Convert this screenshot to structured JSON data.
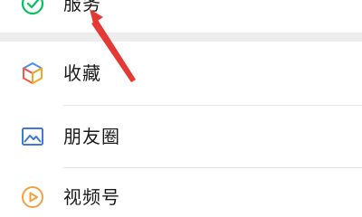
{
  "menu": {
    "items": [
      {
        "label": "服务",
        "icon": "services-icon"
      },
      {
        "label": "收藏",
        "icon": "favorites-cube-icon"
      },
      {
        "label": "朋友圈",
        "icon": "moments-picture-icon"
      },
      {
        "label": "视频号",
        "icon": "channels-play-icon"
      }
    ]
  },
  "colors": {
    "services_green": "#07c160",
    "favorites_orange": "#f6a623",
    "favorites_blue": "#4a8ef0",
    "favorites_red": "#f25a4a",
    "moments_blue": "#3d7bd6",
    "channels_orange": "#f0a140",
    "divider": "#e7e7e7",
    "section_gap": "#ededed",
    "annotation_arrow": "#e53935"
  },
  "annotation": {
    "type": "arrow",
    "points_to": "服务"
  }
}
